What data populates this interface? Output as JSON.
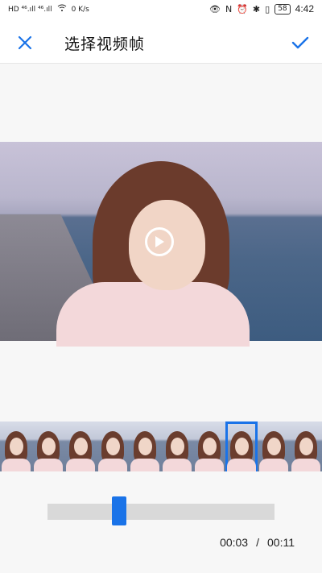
{
  "status_bar": {
    "left_text": "HD ⁴⁶.ıll ⁴⁶.ıll",
    "speed": "0 K/s",
    "battery": "58",
    "time": "4:42"
  },
  "header": {
    "title": "选择视频帧",
    "close_icon": "close-icon",
    "confirm_icon": "check-icon",
    "accent": "#1a73e8"
  },
  "video": {
    "play_icon": "play-icon"
  },
  "filmstrip": {
    "frame_count": 10,
    "selected_index": 7
  },
  "slider": {
    "position_fraction": 0.27
  },
  "playback": {
    "current": "00:03",
    "separator": "/",
    "total": "00:11"
  }
}
